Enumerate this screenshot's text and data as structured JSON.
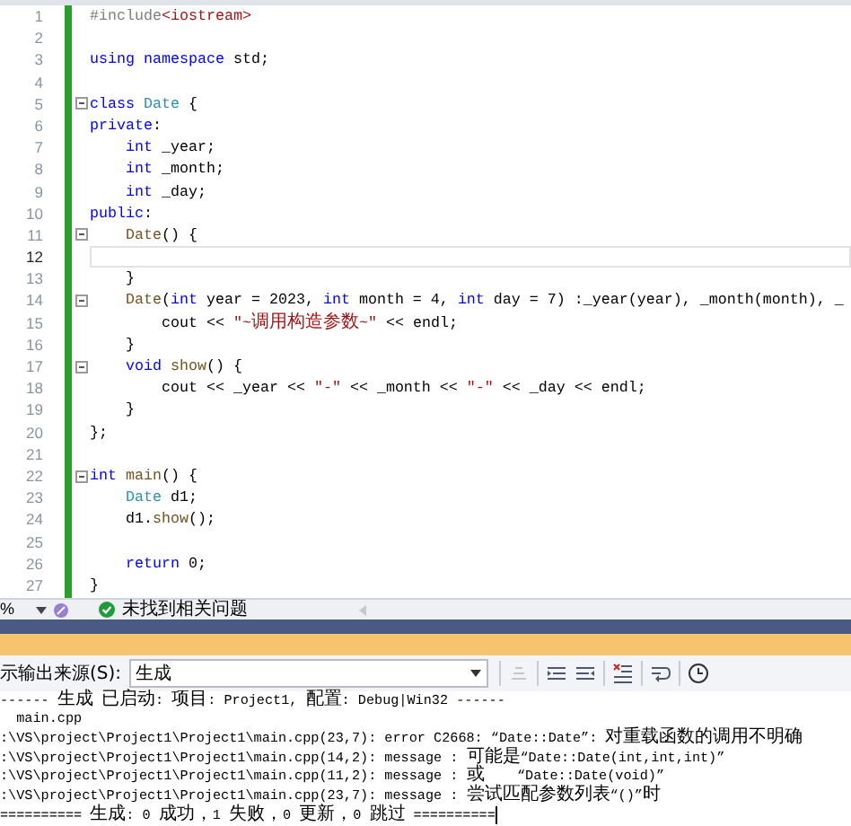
{
  "editor": {
    "lines": [
      {
        "number": "1",
        "fold": false,
        "current": false,
        "segments": [
          {
            "kind": "preprocessor",
            "text": "#include"
          },
          {
            "kind": "string",
            "text": "<iostream>"
          }
        ]
      },
      {
        "number": "2",
        "fold": false,
        "current": false
      },
      {
        "number": "3",
        "fold": false,
        "current": false,
        "segments": [
          {
            "kind": "keyword",
            "text": "using"
          },
          {
            "kind": "keyword",
            "text": " namespace"
          },
          {
            "kind": "plain",
            "text": " std;"
          }
        ]
      },
      {
        "number": "4",
        "fold": false,
        "current": false
      },
      {
        "number": "5",
        "fold": true,
        "current": false,
        "segments": [
          {
            "kind": "keyword",
            "text": "class"
          },
          {
            "kind": "type",
            "text": " Date"
          },
          {
            "kind": "plain",
            "text": " {"
          }
        ]
      },
      {
        "number": "6",
        "fold": false,
        "current": false,
        "segments": [
          {
            "kind": "keyword",
            "text": "private"
          },
          {
            "kind": "plain",
            "text": ":"
          }
        ]
      },
      {
        "number": "7",
        "fold": false,
        "current": false,
        "segments": [
          {
            "kind": "keyword",
            "text": "    int"
          },
          {
            "kind": "plain",
            "text": " _year;"
          }
        ]
      },
      {
        "number": "8",
        "fold": false,
        "current": false,
        "segments": [
          {
            "kind": "keyword",
            "text": "    int"
          },
          {
            "kind": "plain",
            "text": " _month;"
          }
        ]
      },
      {
        "number": "9",
        "fold": false,
        "current": false,
        "segments": [
          {
            "kind": "keyword",
            "text": "    int"
          },
          {
            "kind": "plain",
            "text": " _day;"
          }
        ]
      },
      {
        "number": "10",
        "fold": false,
        "current": false,
        "segments": [
          {
            "kind": "keyword",
            "text": "public"
          },
          {
            "kind": "plain",
            "text": ":"
          }
        ]
      },
      {
        "number": "11",
        "fold": true,
        "current": false,
        "segments": [
          {
            "kind": "function",
            "text": "    Date"
          },
          {
            "kind": "plain",
            "text": "() {"
          }
        ]
      },
      {
        "number": "12",
        "fold": false,
        "current": true
      },
      {
        "number": "13",
        "fold": false,
        "current": false,
        "segments": [
          {
            "kind": "plain",
            "text": "    }"
          }
        ]
      },
      {
        "number": "14",
        "fold": true,
        "current": false,
        "segments": [
          {
            "kind": "function",
            "text": "    Date"
          },
          {
            "kind": "plain",
            "text": "("
          },
          {
            "kind": "keyword",
            "text": "int"
          },
          {
            "kind": "plain",
            "text": " year = 2023, "
          },
          {
            "kind": "keyword",
            "text": "int"
          },
          {
            "kind": "plain",
            "text": " month = 4, "
          },
          {
            "kind": "keyword",
            "text": "int"
          },
          {
            "kind": "plain",
            "text": " day = 7) :_year(year), _month(month), _"
          }
        ]
      },
      {
        "number": "15",
        "fold": false,
        "current": false,
        "segments": [
          {
            "kind": "plain",
            "text": "        cout << "
          },
          {
            "kind": "string",
            "text": "\"~调用构造参数~\""
          },
          {
            "kind": "plain",
            "text": " << endl;"
          }
        ]
      },
      {
        "number": "16",
        "fold": false,
        "current": false,
        "segments": [
          {
            "kind": "plain",
            "text": "    }"
          }
        ]
      },
      {
        "number": "17",
        "fold": true,
        "current": false,
        "segments": [
          {
            "kind": "keyword",
            "text": "    void"
          },
          {
            "kind": "function",
            "text": " show"
          },
          {
            "kind": "plain",
            "text": "() {"
          }
        ]
      },
      {
        "number": "18",
        "fold": false,
        "current": false,
        "segments": [
          {
            "kind": "plain",
            "text": "        cout << _year << "
          },
          {
            "kind": "string",
            "text": "\"-\""
          },
          {
            "kind": "plain",
            "text": " << _month << "
          },
          {
            "kind": "string",
            "text": "\"-\""
          },
          {
            "kind": "plain",
            "text": " << _day << endl;"
          }
        ]
      },
      {
        "number": "19",
        "fold": false,
        "current": false,
        "segments": [
          {
            "kind": "plain",
            "text": "    }"
          }
        ]
      },
      {
        "number": "20",
        "fold": false,
        "current": false,
        "segments": [
          {
            "kind": "plain",
            "text": "};"
          }
        ]
      },
      {
        "number": "21",
        "fold": false,
        "current": false
      },
      {
        "number": "22",
        "fold": true,
        "current": false,
        "segments": [
          {
            "kind": "keyword",
            "text": "int"
          },
          {
            "kind": "function",
            "text": " main"
          },
          {
            "kind": "plain",
            "text": "() {"
          }
        ]
      },
      {
        "number": "23",
        "fold": false,
        "current": false,
        "segments": [
          {
            "kind": "type",
            "text": "    Date"
          },
          {
            "kind": "plain",
            "text": " d1;"
          }
        ]
      },
      {
        "number": "24",
        "fold": false,
        "current": false,
        "segments": [
          {
            "kind": "plain",
            "text": "    d1."
          },
          {
            "kind": "function",
            "text": "show"
          },
          {
            "kind": "plain",
            "text": "();"
          }
        ]
      },
      {
        "number": "25",
        "fold": false,
        "current": false
      },
      {
        "number": "26",
        "fold": false,
        "current": false,
        "segments": [
          {
            "kind": "keyword",
            "text": "    return"
          },
          {
            "kind": "plain",
            "text": " 0;"
          }
        ]
      },
      {
        "number": "27",
        "fold": false,
        "current": false,
        "segments": [
          {
            "kind": "plain",
            "text": "}"
          }
        ]
      }
    ]
  },
  "status_bar": {
    "zoom": "%",
    "message": "未找到相关问题"
  },
  "output": {
    "source_label": "示输出来源(S):",
    "source": "生成",
    "lines": [
      "------ 生成 已启动: 项目: Project1, 配置: Debug|Win32 ------",
      "  main.cpp",
      ":\\VS\\project\\Project1\\Project1\\main.cpp(23,7): error C2668: “Date::Date”: 对重载函数的调用不明确",
      ":\\VS\\project\\Project1\\Project1\\main.cpp(14,2): message : 可能是“Date::Date(int,int,int)”",
      ":\\VS\\project\\Project1\\Project1\\main.cpp(11,2): message : 或    “Date::Date(void)”",
      ":\\VS\\project\\Project1\\Project1\\main.cpp(23,7): message : 尝试匹配参数列表“()”时",
      "========== 生成: 0 成功，1 失败，0 更新，0 跳过 =========="
    ]
  }
}
